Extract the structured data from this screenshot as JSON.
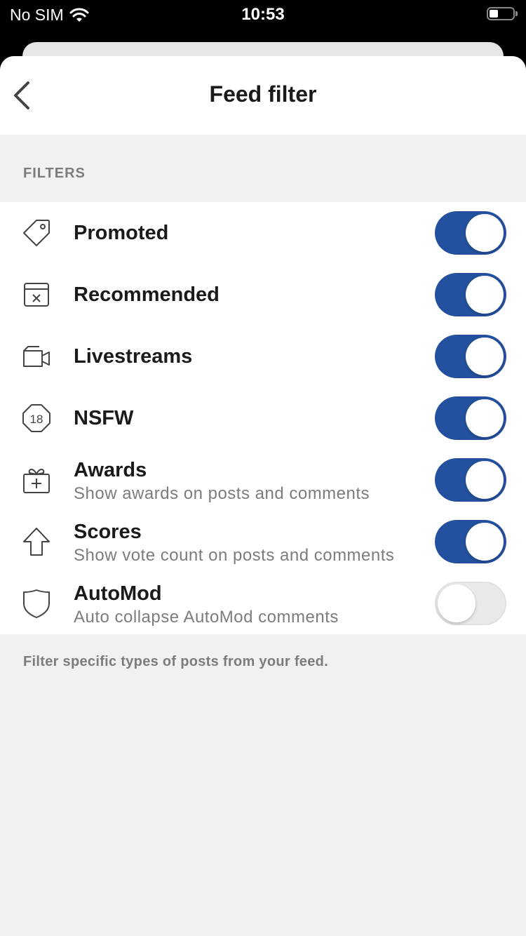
{
  "status_bar": {
    "carrier": "No SIM",
    "time": "10:53"
  },
  "nav": {
    "title": "Feed filter"
  },
  "section_header": "FILTERS",
  "filters": [
    {
      "title": "Promoted",
      "subtitle": "",
      "icon": "tag-icon",
      "enabled": true
    },
    {
      "title": "Recommended",
      "subtitle": "",
      "icon": "calendar-x-icon",
      "enabled": true
    },
    {
      "title": "Livestreams",
      "subtitle": "",
      "icon": "video-camera-icon",
      "enabled": true
    },
    {
      "title": "NSFW",
      "subtitle": "",
      "icon": "nsfw-18-icon",
      "enabled": true
    },
    {
      "title": "Awards",
      "subtitle": "Show awards on posts and comments",
      "icon": "gift-icon",
      "enabled": true
    },
    {
      "title": "Scores",
      "subtitle": "Show vote count on posts and comments",
      "icon": "upvote-arrow-icon",
      "enabled": true
    },
    {
      "title": "AutoMod",
      "subtitle": "Auto collapse AutoMod comments",
      "icon": "shield-icon",
      "enabled": false
    }
  ],
  "footer_note": "Filter specific types of posts from your feed.",
  "colors": {
    "toggle_on": "#24519f",
    "toggle_off": "#e9e9eb",
    "background": "#f0f1f3"
  }
}
